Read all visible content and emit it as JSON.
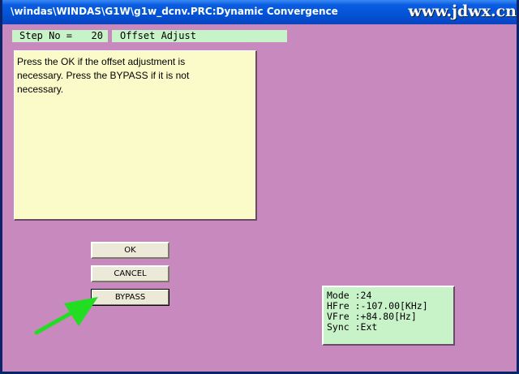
{
  "window": {
    "title": "\\windas\\WINDAS\\G1W\\g1w_dcnv.PRC:Dynamic Convergence",
    "watermark": "www.jdwx.cn"
  },
  "step": {
    "label": "Step No =",
    "number": "20",
    "name": "Offset Adjust"
  },
  "message": {
    "text": "Press the OK if the offset adjustment is necessary. Press the BYPASS if it is not necessary."
  },
  "buttons": {
    "ok": "OK",
    "cancel": "CANCEL",
    "bypass": "BYPASS"
  },
  "status": {
    "mode": "Mode :24",
    "hfre": "HFre :-107.00[KHz]",
    "vfre": "VFre :+84.80[Hz]",
    "sync": "Sync :Ext"
  },
  "annotation": {
    "arrow_icon": "green-arrow-icon",
    "arrow_color": "#22dd22"
  },
  "colors": {
    "background": "#c789be",
    "message_bg": "#fbfbc9",
    "info_bg": "#c8f3c8",
    "titlebar": "#0253d6"
  }
}
